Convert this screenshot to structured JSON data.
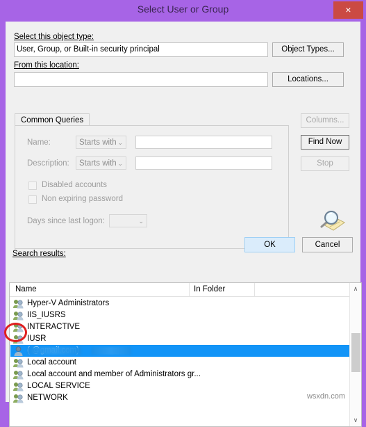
{
  "window": {
    "title": "Select User or Group",
    "close_label": "×",
    "accent_purple": "#a764e6",
    "close_red": "#cb4a43",
    "selection_blue": "#1294f7"
  },
  "object_type": {
    "label": "Select this object type:",
    "value": "User, Group, or Built-in security principal",
    "button": "Object Types..."
  },
  "location": {
    "label": "From this location:",
    "value": "",
    "button": "Locations..."
  },
  "tabs": [
    {
      "label": "Common Queries",
      "active": true
    }
  ],
  "query": {
    "name_label": "Name:",
    "name_operator": "Starts with",
    "name_value": "",
    "description_label": "Description:",
    "description_operator": "Starts with",
    "description_value": "",
    "disabled_accounts_label": "Disabled accounts",
    "disabled_accounts_checked": false,
    "non_expiring_label": "Non expiring password",
    "non_expiring_checked": false,
    "days_label": "Days since last logon:",
    "days_value": "",
    "dropdown_arrow": "⌄"
  },
  "side_buttons": {
    "columns": "Columns...",
    "find_now": "Find Now",
    "stop": "Stop",
    "search_icon": "magnifier-folder-icon"
  },
  "dialog_buttons": {
    "ok": "OK",
    "cancel": "Cancel"
  },
  "results": {
    "label": "Search results:",
    "columns": [
      "Name",
      "In Folder"
    ],
    "scroll_up": "∧",
    "scroll_down": "∨",
    "rows": [
      {
        "name": "Hyper-V Administrators",
        "folder": "",
        "icon": "group-icon",
        "selected": false
      },
      {
        "name": "IIS_IUSRS",
        "folder": "",
        "icon": "group-icon",
        "selected": false
      },
      {
        "name": "INTERACTIVE",
        "folder": "",
        "icon": "group-icon",
        "selected": false
      },
      {
        "name": "IUSR",
        "folder": "",
        "icon": "group-icon",
        "selected": false
      },
      {
        "name": "(                    @gmail.com)",
        "folder": "",
        "icon": "user-icon",
        "selected": true,
        "redacted": true
      },
      {
        "name": "Local account",
        "folder": "",
        "icon": "group-icon",
        "selected": false
      },
      {
        "name": "Local account and member of Administrators gr...",
        "folder": "",
        "icon": "group-icon",
        "selected": false
      },
      {
        "name": "LOCAL SERVICE",
        "folder": "",
        "icon": "group-icon",
        "selected": false
      },
      {
        "name": "NETWORK",
        "folder": "",
        "icon": "group-icon",
        "selected": false
      }
    ]
  },
  "annotation": {
    "shape": "red-circle",
    "target": "selected-row-user-icon",
    "color": "#e02020"
  },
  "watermark": "wsxdn.com"
}
